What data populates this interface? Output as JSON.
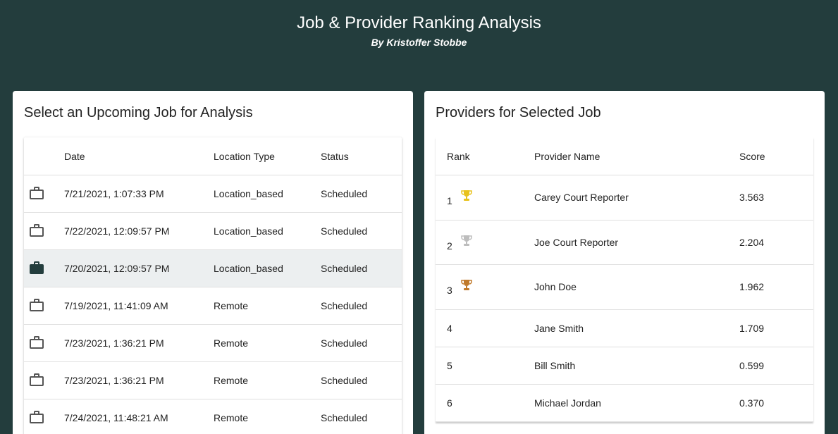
{
  "header": {
    "title": "Job & Provider Ranking Analysis",
    "subtitle": "By Kristoffer Stobbe"
  },
  "jobs_panel": {
    "title": "Select an Upcoming Job for Analysis",
    "columns": [
      "Date",
      "Location Type",
      "Status"
    ],
    "rows": [
      {
        "date": "7/21/2021, 1:07:33 PM",
        "location_type": "Location_based",
        "status": "Scheduled",
        "selected": false
      },
      {
        "date": "7/22/2021, 12:09:57 PM",
        "location_type": "Location_based",
        "status": "Scheduled",
        "selected": false
      },
      {
        "date": "7/20/2021, 12:09:57 PM",
        "location_type": "Location_based",
        "status": "Scheduled",
        "selected": true
      },
      {
        "date": "7/19/2021, 11:41:09 AM",
        "location_type": "Remote",
        "status": "Scheduled",
        "selected": false
      },
      {
        "date": "7/23/2021, 1:36:21 PM",
        "location_type": "Remote",
        "status": "Scheduled",
        "selected": false
      },
      {
        "date": "7/23/2021, 1:36:21 PM",
        "location_type": "Remote",
        "status": "Scheduled",
        "selected": false
      },
      {
        "date": "7/24/2021, 11:48:21 AM",
        "location_type": "Remote",
        "status": "Scheduled",
        "selected": false
      }
    ],
    "row_icon": "briefcase-icon"
  },
  "providers_panel": {
    "title": "Providers for Selected Job",
    "columns": [
      "Rank",
      "Provider Name",
      "Score"
    ],
    "rows": [
      {
        "rank": "1",
        "name": "Carey Court Reporter",
        "score": "3.563",
        "trophy": "gold-trophy-icon"
      },
      {
        "rank": "2",
        "name": "Joe Court Reporter",
        "score": "2.204",
        "trophy": "silver-trophy-icon"
      },
      {
        "rank": "3",
        "name": "John Doe",
        "score": "1.962",
        "trophy": "bronze-trophy-icon"
      },
      {
        "rank": "4",
        "name": "Jane Smith",
        "score": "1.709"
      },
      {
        "rank": "5",
        "name": "Bill Smith",
        "score": "0.599"
      },
      {
        "rank": "6",
        "name": "Michael Jordan",
        "score": "0.370"
      }
    ]
  },
  "colors": {
    "background": "#233d3d",
    "selected_row": "#eceff0",
    "gold": "#e8c21c",
    "silver": "#bdbdbd",
    "bronze": "#c07a2c"
  }
}
